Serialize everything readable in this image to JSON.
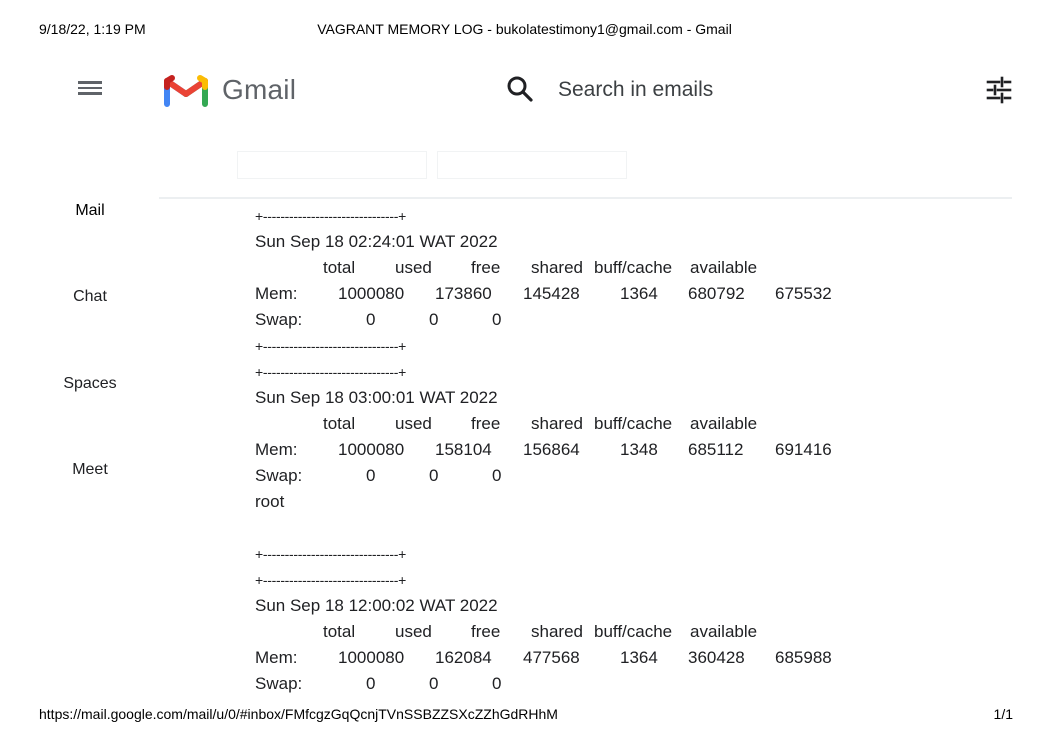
{
  "print": {
    "date": "9/18/22, 1:19 PM",
    "title": "VAGRANT MEMORY LOG - bukolatestimony1@gmail.com - Gmail",
    "url": "https://mail.google.com/mail/u/0/#inbox/FMfcgzGqQcnjTVnSSBZZSXcZZhGdRHhM",
    "page": "1/1"
  },
  "header": {
    "logo_text": "Gmail",
    "search_placeholder": "Search in emails"
  },
  "colors": {
    "gmail_red": "#EA4335",
    "gmail_blue": "#4285F4",
    "gmail_green": "#34A853",
    "gmail_yellow": "#FBBC04",
    "gmail_darkred": "#C5221F"
  },
  "nav": {
    "items": [
      {
        "label": "Mail"
      },
      {
        "label": "Chat"
      },
      {
        "label": "Spaces"
      },
      {
        "label": "Meet"
      }
    ]
  },
  "log": {
    "separator": "+-------------------------------+",
    "header_cols": [
      "total",
      "used",
      "free",
      "shared",
      "buff/cache",
      "available"
    ],
    "entries": [
      {
        "timestamp": "Sun Sep 18 02:24:01 WAT 2022",
        "mem": [
          "Mem:",
          "1000080",
          "173860",
          "145428",
          "1364",
          "680792",
          "675532"
        ],
        "swap": [
          "Swap:",
          "0",
          "0",
          "0"
        ]
      },
      {
        "timestamp": "Sun Sep 18 03:00:01 WAT 2022",
        "mem": [
          "Mem:",
          "1000080",
          "158104",
          "156864",
          "1348",
          "685112",
          "691416"
        ],
        "swap": [
          "Swap:",
          "0",
          "0",
          "0"
        ],
        "extra": "root"
      },
      {
        "timestamp": "Sun Sep 18 12:00:02 WAT 2022",
        "mem": [
          "Mem:",
          "1000080",
          "162084",
          "477568",
          "1364",
          "360428",
          "685988"
        ],
        "swap": [
          "Swap:",
          "0",
          "0",
          "0"
        ]
      }
    ]
  }
}
